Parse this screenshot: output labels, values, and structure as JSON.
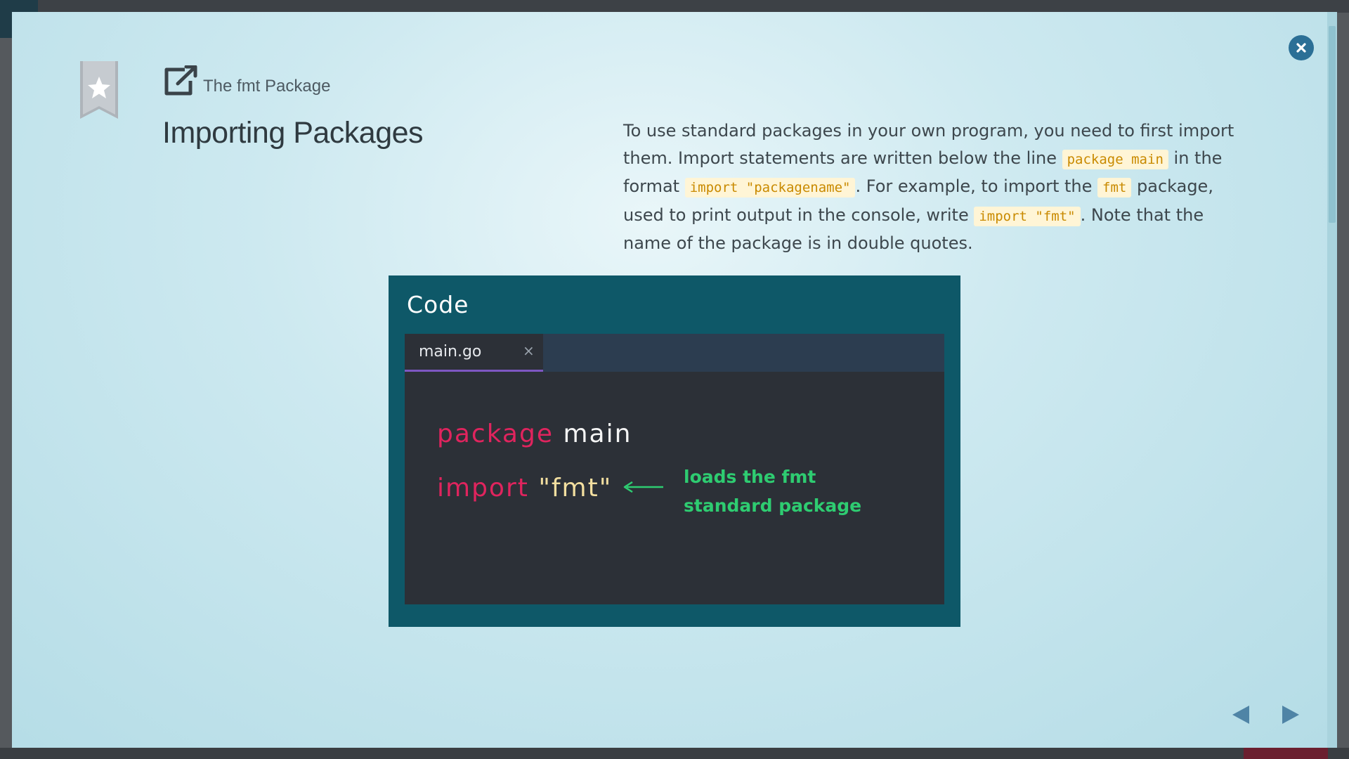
{
  "breadcrumb": {
    "label": "The fmt Package",
    "icon": "external-link-icon"
  },
  "page": {
    "title": "Importing Packages"
  },
  "description": {
    "part1": "To use standard packages in your own program, you need to first import them. Import statements are written below the line ",
    "code1": "package main",
    "part2": " in the format ",
    "code2": "import \"packagename\"",
    "part3": ". For example, to import the ",
    "code3": "fmt",
    "part4": " package, used to print output in the console, write ",
    "code4": "import \"fmt\"",
    "part5": ". Note that the name of the package is in double quotes."
  },
  "code_card": {
    "title": "Code",
    "tab_label": "main.go",
    "tab_close": "×",
    "line1_keyword": "package",
    "line1_ident": "main",
    "line2_keyword": "import",
    "line2_string": "\"fmt\"",
    "annotation_line1": "loads the fmt",
    "annotation_line2": "standard package"
  },
  "colors": {
    "keyword": "#e0245e",
    "string": "#f3dfa0",
    "annotation": "#2ecc71",
    "card_bg": "#0e5868",
    "accent_tab": "#7e57c2",
    "close_button": "#2b6f96",
    "nav_arrow": "#4f84a6"
  },
  "icons": {
    "close": "close-icon",
    "bookmark": "bookmark-star-icon",
    "prev": "triangle-left-icon",
    "next": "triangle-right-icon"
  }
}
